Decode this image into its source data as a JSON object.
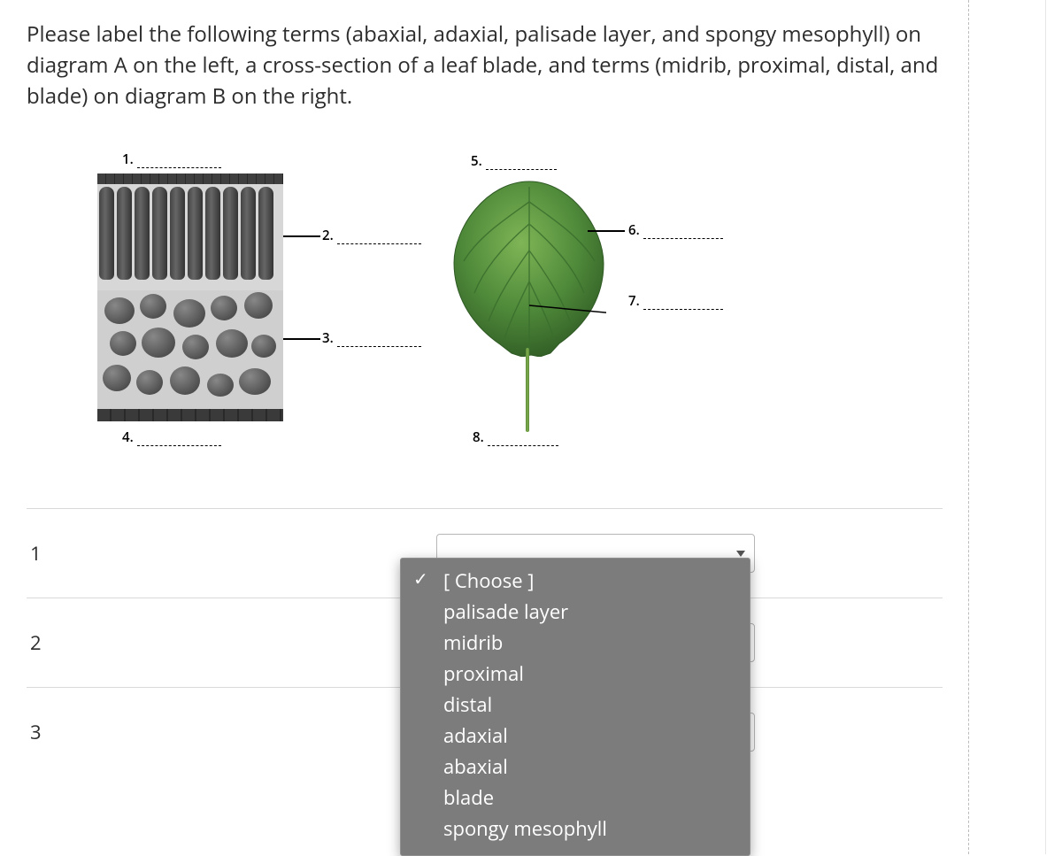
{
  "question": "Please label the following terms (abaxial, adaxial, palisade layer, and spongy mesophyll) on diagram A on the left, a cross-section of a leaf blade, and terms (midrib, proximal, distal, and blade) on diagram B on the right.",
  "diagramA": {
    "labels": {
      "n1": "1.",
      "n2": "2.",
      "n3": "3.",
      "n4": "4."
    }
  },
  "diagramB": {
    "labels": {
      "n5": "5.",
      "n6": "6.",
      "n7": "7.",
      "n8": "8."
    }
  },
  "answers": {
    "rows": [
      {
        "num": "1"
      },
      {
        "num": "2"
      },
      {
        "num": "3"
      }
    ]
  },
  "dropdown": {
    "options": [
      {
        "label": "[ Choose ]",
        "selected": true
      },
      {
        "label": "palisade layer",
        "selected": false
      },
      {
        "label": "midrib",
        "selected": false
      },
      {
        "label": "proximal",
        "selected": false
      },
      {
        "label": "distal",
        "selected": false
      },
      {
        "label": "adaxial",
        "selected": false
      },
      {
        "label": "abaxial",
        "selected": false
      },
      {
        "label": "blade",
        "selected": false
      },
      {
        "label": "spongy mesophyll",
        "selected": false
      }
    ]
  }
}
